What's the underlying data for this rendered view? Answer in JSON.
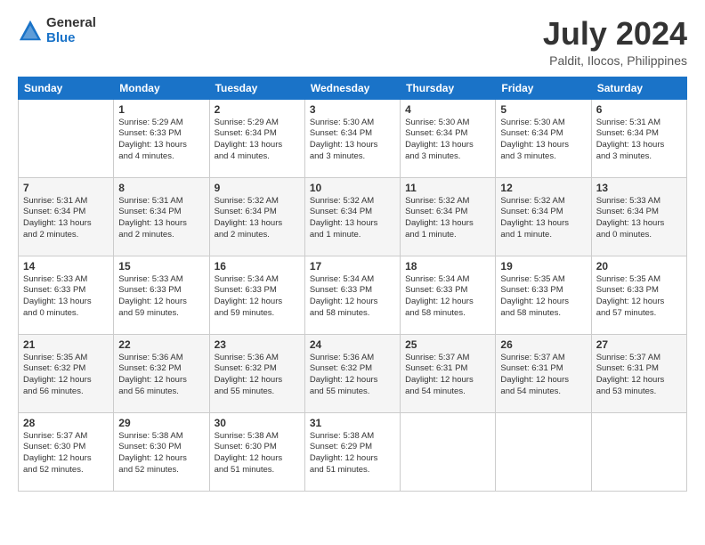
{
  "logo": {
    "general": "General",
    "blue": "Blue"
  },
  "header": {
    "title": "July 2024",
    "subtitle": "Paldit, Ilocos, Philippines"
  },
  "days_of_week": [
    "Sunday",
    "Monday",
    "Tuesday",
    "Wednesday",
    "Thursday",
    "Friday",
    "Saturday"
  ],
  "weeks": [
    [
      {
        "day": "",
        "info": ""
      },
      {
        "day": "1",
        "info": "Sunrise: 5:29 AM\nSunset: 6:33 PM\nDaylight: 13 hours\nand 4 minutes."
      },
      {
        "day": "2",
        "info": "Sunrise: 5:29 AM\nSunset: 6:34 PM\nDaylight: 13 hours\nand 4 minutes."
      },
      {
        "day": "3",
        "info": "Sunrise: 5:30 AM\nSunset: 6:34 PM\nDaylight: 13 hours\nand 3 minutes."
      },
      {
        "day": "4",
        "info": "Sunrise: 5:30 AM\nSunset: 6:34 PM\nDaylight: 13 hours\nand 3 minutes."
      },
      {
        "day": "5",
        "info": "Sunrise: 5:30 AM\nSunset: 6:34 PM\nDaylight: 13 hours\nand 3 minutes."
      },
      {
        "day": "6",
        "info": "Sunrise: 5:31 AM\nSunset: 6:34 PM\nDaylight: 13 hours\nand 3 minutes."
      }
    ],
    [
      {
        "day": "7",
        "info": "Sunrise: 5:31 AM\nSunset: 6:34 PM\nDaylight: 13 hours\nand 2 minutes."
      },
      {
        "day": "8",
        "info": "Sunrise: 5:31 AM\nSunset: 6:34 PM\nDaylight: 13 hours\nand 2 minutes."
      },
      {
        "day": "9",
        "info": "Sunrise: 5:32 AM\nSunset: 6:34 PM\nDaylight: 13 hours\nand 2 minutes."
      },
      {
        "day": "10",
        "info": "Sunrise: 5:32 AM\nSunset: 6:34 PM\nDaylight: 13 hours\nand 1 minute."
      },
      {
        "day": "11",
        "info": "Sunrise: 5:32 AM\nSunset: 6:34 PM\nDaylight: 13 hours\nand 1 minute."
      },
      {
        "day": "12",
        "info": "Sunrise: 5:32 AM\nSunset: 6:34 PM\nDaylight: 13 hours\nand 1 minute."
      },
      {
        "day": "13",
        "info": "Sunrise: 5:33 AM\nSunset: 6:34 PM\nDaylight: 13 hours\nand 0 minutes."
      }
    ],
    [
      {
        "day": "14",
        "info": "Sunrise: 5:33 AM\nSunset: 6:33 PM\nDaylight: 13 hours\nand 0 minutes."
      },
      {
        "day": "15",
        "info": "Sunrise: 5:33 AM\nSunset: 6:33 PM\nDaylight: 12 hours\nand 59 minutes."
      },
      {
        "day": "16",
        "info": "Sunrise: 5:34 AM\nSunset: 6:33 PM\nDaylight: 12 hours\nand 59 minutes."
      },
      {
        "day": "17",
        "info": "Sunrise: 5:34 AM\nSunset: 6:33 PM\nDaylight: 12 hours\nand 58 minutes."
      },
      {
        "day": "18",
        "info": "Sunrise: 5:34 AM\nSunset: 6:33 PM\nDaylight: 12 hours\nand 58 minutes."
      },
      {
        "day": "19",
        "info": "Sunrise: 5:35 AM\nSunset: 6:33 PM\nDaylight: 12 hours\nand 58 minutes."
      },
      {
        "day": "20",
        "info": "Sunrise: 5:35 AM\nSunset: 6:33 PM\nDaylight: 12 hours\nand 57 minutes."
      }
    ],
    [
      {
        "day": "21",
        "info": "Sunrise: 5:35 AM\nSunset: 6:32 PM\nDaylight: 12 hours\nand 56 minutes."
      },
      {
        "day": "22",
        "info": "Sunrise: 5:36 AM\nSunset: 6:32 PM\nDaylight: 12 hours\nand 56 minutes."
      },
      {
        "day": "23",
        "info": "Sunrise: 5:36 AM\nSunset: 6:32 PM\nDaylight: 12 hours\nand 55 minutes."
      },
      {
        "day": "24",
        "info": "Sunrise: 5:36 AM\nSunset: 6:32 PM\nDaylight: 12 hours\nand 55 minutes."
      },
      {
        "day": "25",
        "info": "Sunrise: 5:37 AM\nSunset: 6:31 PM\nDaylight: 12 hours\nand 54 minutes."
      },
      {
        "day": "26",
        "info": "Sunrise: 5:37 AM\nSunset: 6:31 PM\nDaylight: 12 hours\nand 54 minutes."
      },
      {
        "day": "27",
        "info": "Sunrise: 5:37 AM\nSunset: 6:31 PM\nDaylight: 12 hours\nand 53 minutes."
      }
    ],
    [
      {
        "day": "28",
        "info": "Sunrise: 5:37 AM\nSunset: 6:30 PM\nDaylight: 12 hours\nand 52 minutes."
      },
      {
        "day": "29",
        "info": "Sunrise: 5:38 AM\nSunset: 6:30 PM\nDaylight: 12 hours\nand 52 minutes."
      },
      {
        "day": "30",
        "info": "Sunrise: 5:38 AM\nSunset: 6:30 PM\nDaylight: 12 hours\nand 51 minutes."
      },
      {
        "day": "31",
        "info": "Sunrise: 5:38 AM\nSunset: 6:29 PM\nDaylight: 12 hours\nand 51 minutes."
      },
      {
        "day": "",
        "info": ""
      },
      {
        "day": "",
        "info": ""
      },
      {
        "day": "",
        "info": ""
      }
    ]
  ]
}
